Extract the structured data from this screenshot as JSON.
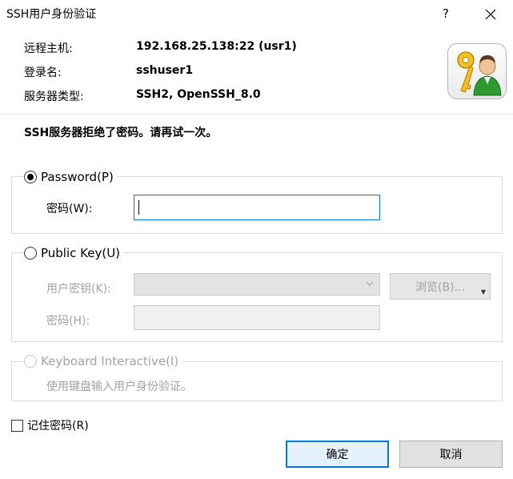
{
  "window": {
    "title": "SSH用户身份验证",
    "help_glyph": "?",
    "close_icon": "close-icon"
  },
  "info": {
    "host_label": "远程主机:",
    "host_value": "192.168.25.138:22 (usr1)",
    "login_label": "登录名:",
    "login_value": "sshuser1",
    "server_type_label": "服务器类型:",
    "server_type_value": "SSH2, OpenSSH_8.0"
  },
  "error_message": "SSH服务器拒绝了密码。请再试一次。",
  "password_group": {
    "label": "Password(P)",
    "selected": true,
    "password_label": "密码(W):",
    "password_value": ""
  },
  "public_key_group": {
    "label": "Public Key(U)",
    "selected": false,
    "user_key_label": "用户密钥(K):",
    "user_key_value": "",
    "browse_label": "浏览(B)...",
    "passphrase_label": "密码(H):",
    "passphrase_value": ""
  },
  "keyboard_group": {
    "label": "Keyboard Interactive(I)",
    "selected": false,
    "description": "使用键盘输入用户身份验证。"
  },
  "remember_password": {
    "label": "记住密码(R)",
    "checked": false
  },
  "buttons": {
    "ok": "确定",
    "cancel": "取消"
  },
  "colors": {
    "accent": "#0078d7",
    "disabled_text": "#a3a3a3",
    "group_border": "#dcdcdc"
  }
}
